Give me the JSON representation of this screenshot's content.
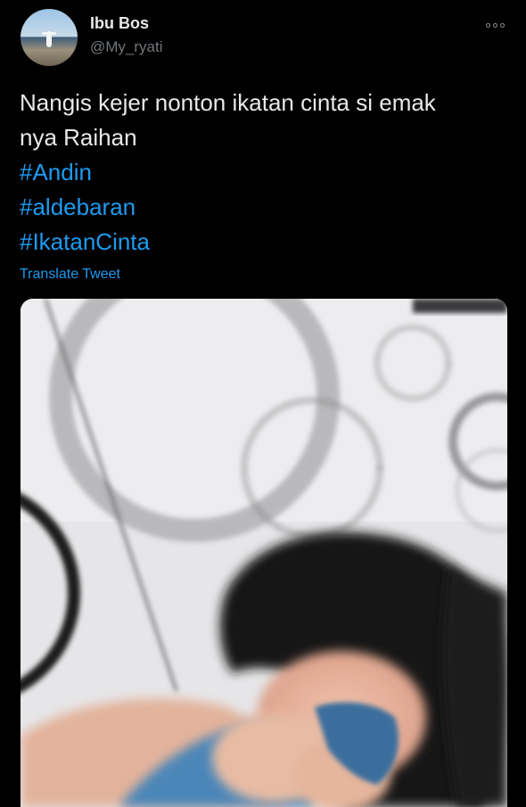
{
  "tweet": {
    "author": {
      "display_name": "Ibu Bos",
      "handle": "@My_ryati",
      "avatar_icon": "profile-avatar"
    },
    "more_icon": "more-options-icon",
    "text_lines": [
      "Nangis kejer nonton ikatan cinta si emak",
      "nya Raihan"
    ],
    "hashtags": [
      "#Andin",
      "#aldebaran",
      "#IkatanCinta"
    ],
    "translate_label": "Translate Tweet",
    "media": {
      "type": "video-still",
      "icon": "media-image"
    }
  },
  "colors": {
    "background": "#000000",
    "text": "#e7e9ea",
    "secondary_text": "#71767b",
    "link": "#1d9bf0"
  }
}
